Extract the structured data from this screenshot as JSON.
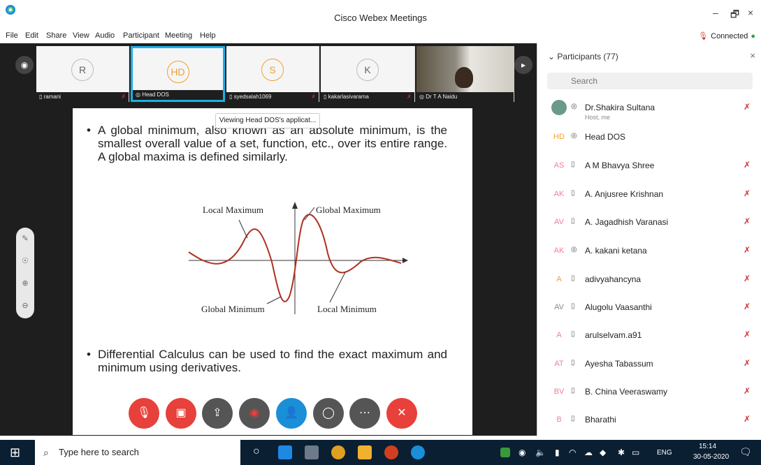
{
  "window": {
    "title": "Cisco Webex Meetings",
    "minimize": "–",
    "restore": "🗗",
    "close": "×"
  },
  "menu": {
    "items": [
      "File",
      "Edit",
      "Share",
      "View",
      "Audio",
      "Participant",
      "Meeting",
      "Help"
    ],
    "status": "Connected"
  },
  "video_strip": {
    "tiles": [
      {
        "initial": "R",
        "name": "ramani"
      },
      {
        "initial": "HD",
        "name": "Head DOS"
      },
      {
        "initial": "S",
        "name": "syedsalah1069"
      },
      {
        "initial": "K",
        "name": "kakarlasivarama"
      },
      {
        "initial": "",
        "name": "Dr T A Naidu"
      }
    ]
  },
  "tooltip": "Viewing Head DOS's applicat...",
  "slide": {
    "bullet1": "A global minimum, also known as an absolute minimum, is the smallest overall value of a set, function, etc., over its entire range. A global maxima is defined similarly.",
    "bullet2": "Differential Calculus can be used to find the exact maximum and minimum using derivatives.",
    "labels": {
      "local_max": "Local Maximum",
      "global_max": "Global Maximum",
      "global_min": "Global Minimum",
      "local_min": "Local Minimum"
    }
  },
  "panel": {
    "title": "Participants (77)",
    "close": "×",
    "search_placeholder": "Search",
    "participants": [
      {
        "initials": "",
        "name": "Dr.Shakira  Sultana",
        "sub": "Host, me",
        "muted": true
      },
      {
        "initials": "HD",
        "name": "Head DOS",
        "sub": "",
        "muted": false
      },
      {
        "initials": "AS",
        "name": "A M Bhavya Shree",
        "sub": "",
        "muted": true
      },
      {
        "initials": "AK",
        "name": "A. Anjusree Krishnan",
        "sub": "",
        "muted": true
      },
      {
        "initials": "AV",
        "name": "A. Jagadhish Varanasi",
        "sub": "",
        "muted": true
      },
      {
        "initials": "AK",
        "name": "A. kakani ketana",
        "sub": "",
        "muted": true
      },
      {
        "initials": "A",
        "name": "adivyahancyna",
        "sub": "",
        "muted": true
      },
      {
        "initials": "AV",
        "name": "Alugolu Vaasanthi",
        "sub": "",
        "muted": true
      },
      {
        "initials": "A",
        "name": "arulselvam.a91",
        "sub": "",
        "muted": true
      },
      {
        "initials": "AT",
        "name": "Ayesha Tabassum",
        "sub": "",
        "muted": true
      },
      {
        "initials": "BV",
        "name": "B. China Veeraswamy",
        "sub": "",
        "muted": true
      },
      {
        "initials": "B",
        "name": "Bharathi",
        "sub": "",
        "muted": true
      }
    ]
  },
  "taskbar": {
    "search_placeholder": "Type here to search",
    "lang": "ENG",
    "time": "15:14",
    "date": "30-05-2020"
  },
  "colors": {
    "accent": "#1ab0e8",
    "red": "#e8403a",
    "dark": "#1e1e1e"
  }
}
